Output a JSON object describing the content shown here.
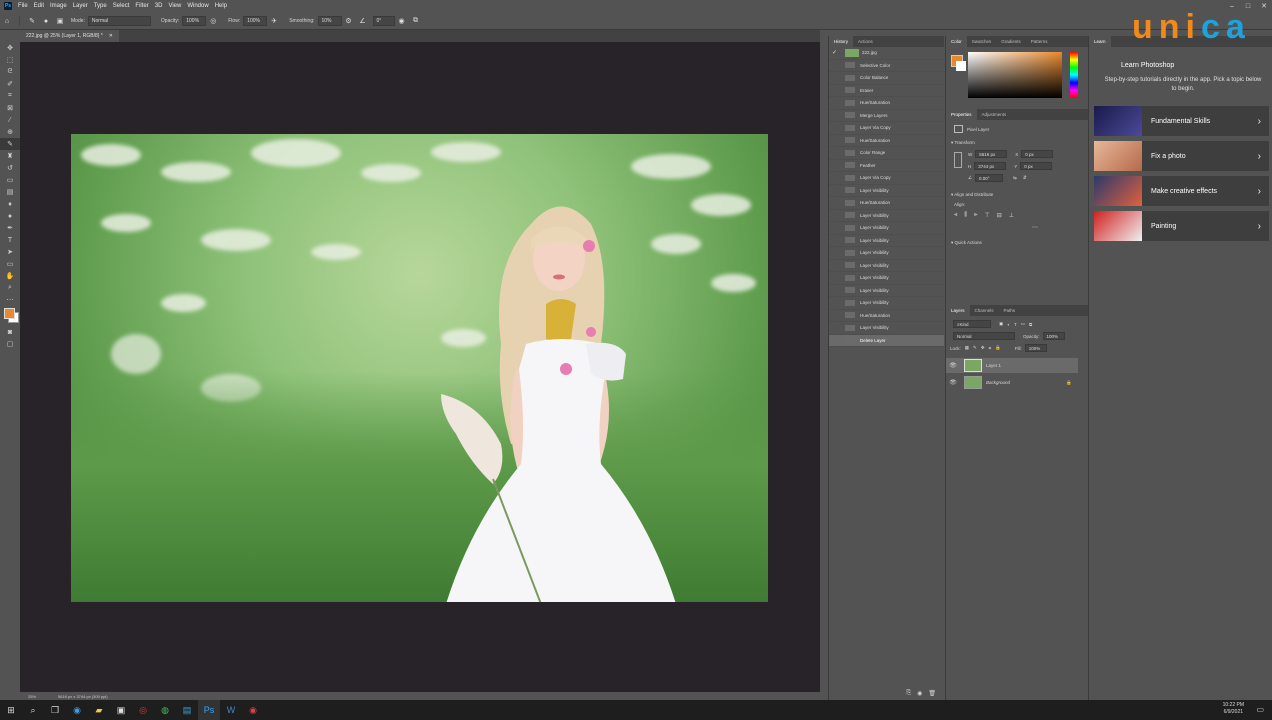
{
  "menubar": {
    "app_icon": "Ps",
    "items": [
      "File",
      "Edit",
      "Image",
      "Layer",
      "Type",
      "Select",
      "Filter",
      "3D",
      "View",
      "Window",
      "Help"
    ]
  },
  "window_controls": {
    "minimize": "–",
    "maximize": "□",
    "close": "✕"
  },
  "options": {
    "mode_label": "Mode:",
    "mode_value": "Normal",
    "opacity_label": "Opacity:",
    "opacity_value": "100%",
    "flow_label": "Flow:",
    "flow_value": "100%",
    "smoothing_label": "Smoothing:",
    "smoothing_value": "10%",
    "angle_value": "0°"
  },
  "document": {
    "tab_title": "222.jpg @ 25% (Layer 1, RGB/8) *",
    "zoom": "25%",
    "doc_info": "5616 px x 3744 px (300 ppi)"
  },
  "history": {
    "tabs": [
      "History",
      "Actions"
    ],
    "snapshot": "222.jpg",
    "steps": [
      "Selective Color",
      "Color Balance",
      "Eraser",
      "Hue/Saturation",
      "Merge Layers",
      "Layer Via Copy",
      "Hue/Saturation",
      "Color Range",
      "Feather",
      "Layer Via Copy",
      "Layer Visibility",
      "Hue/Saturation",
      "Layer Visibility",
      "Layer Visibility",
      "Layer Visibility",
      "Layer Visibility",
      "Layer Visibility",
      "Layer Visibility",
      "Layer Visibility",
      "Layer Visibility",
      "Hue/Saturation",
      "Layer Visibility",
      "Delete Layer"
    ],
    "selected_index": 22
  },
  "color": {
    "tabs": [
      "Color",
      "Swatches",
      "Gradients",
      "Patterns"
    ],
    "fg_color": "#e8892e",
    "bg_color": "#ffffff"
  },
  "properties": {
    "tabs": [
      "Properties",
      "Adjustments"
    ],
    "kind": "Pixel Layer",
    "transform_label": "Transform",
    "w_label": "W",
    "w_value": "5616 px",
    "h_label": "H",
    "h_value": "3744 px",
    "x_label": "X",
    "x_value": "0 px",
    "y_label": "Y",
    "y_value": "0 px",
    "angle_value": "0.00°",
    "align_label": "Align and Distribute",
    "align_sub": "Align:",
    "quick_actions_label": "Quick Actions"
  },
  "layers": {
    "tabs": [
      "Layers",
      "Channels",
      "Paths"
    ],
    "kind_filter": "Kind",
    "blend_mode": "Normal",
    "opacity_label": "Opacity:",
    "opacity_value": "100%",
    "lock_label": "Lock:",
    "fill_label": "Fill:",
    "fill_value": "100%",
    "items": [
      {
        "name": "Layer 1",
        "selected": true
      },
      {
        "name": "Background",
        "selected": false
      }
    ]
  },
  "learn": {
    "tab": "Learn",
    "title": "Learn Photoshop",
    "description": "Step-by-step tutorials directly in the app. Pick a topic below to begin.",
    "topics": [
      "Fundamental Skills",
      "Fix a photo",
      "Make creative effects",
      "Painting"
    ]
  },
  "taskbar": {
    "time": "10:22 PM",
    "date": "6/9/2021"
  },
  "watermark": {
    "text": "unica",
    "color_primary": "#f08a1c",
    "color_secondary": "#1ea2dc"
  },
  "colors": {
    "ui_bg": "#535353",
    "canvas_bg": "#282328",
    "selection": "#6a6a6a"
  }
}
